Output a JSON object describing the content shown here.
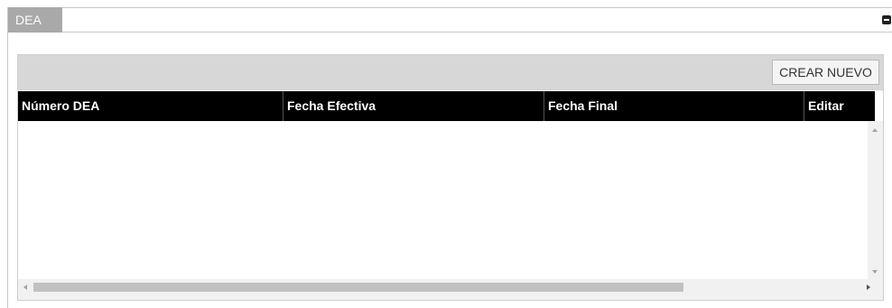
{
  "panel": {
    "tab_label": "DEA"
  },
  "toolbar": {
    "create_label": "CREAR NUEVO"
  },
  "table": {
    "columns": [
      "Número DEA",
      "Fecha Efectiva",
      "Fecha Final",
      "Editar"
    ],
    "rows": []
  },
  "scroll": {
    "horizontal_thumb_fraction": 0.75
  }
}
